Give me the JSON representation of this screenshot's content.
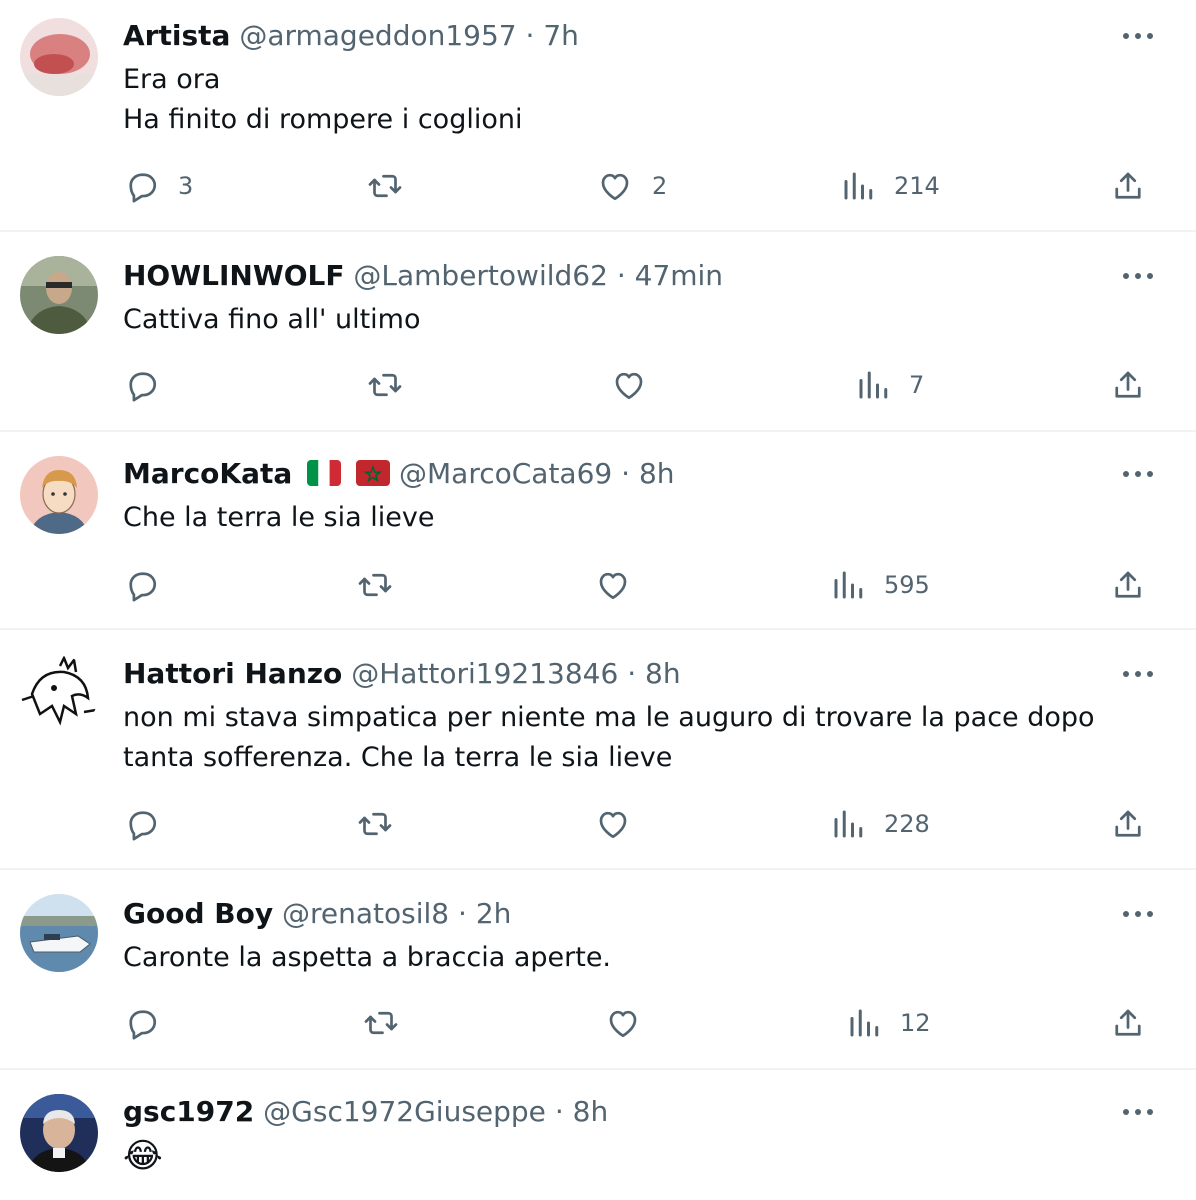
{
  "tweets": [
    {
      "name": "Artista",
      "handle": "@armageddon1957",
      "separator": "·",
      "time": "7h",
      "text": [
        "Era ora",
        "Ha finito di rompere i coglioni"
      ],
      "replies": "3",
      "retweets": "",
      "likes": "2",
      "views": "214"
    },
    {
      "name": "HOWLINWOLF",
      "handle": "@Lambertowild62",
      "separator": "·",
      "time": "47min",
      "text": [
        "Cattiva fino all' ultimo"
      ],
      "replies": "",
      "retweets": "",
      "likes": "",
      "views": "7"
    },
    {
      "name": "MarcoKata",
      "flags": [
        "italy-flag",
        "morocco-flag"
      ],
      "handle": "@MarcoCata69",
      "separator": "·",
      "time": "8h",
      "text": [
        "Che la terra le sia lieve"
      ],
      "replies": "",
      "retweets": "",
      "likes": "",
      "views": "595"
    },
    {
      "name": "Hattori Hanzo",
      "handle": "@Hattori19213846",
      "separator": "·",
      "time": "8h",
      "text": [
        "non mi stava simpatica per niente ma le auguro di trovare la pace dopo",
        "tanta sofferenza. Che la terra le sia lieve"
      ],
      "replies": "",
      "retweets": "",
      "likes": "",
      "views": "228"
    },
    {
      "name": "Good Boy",
      "handle": "@renatosil8",
      "separator": "·",
      "time": "2h",
      "text": [
        "Caronte la aspetta a braccia aperte."
      ],
      "replies": "",
      "retweets": "",
      "likes": "",
      "views": "12"
    },
    {
      "name": "gsc1972",
      "handle": "@Gsc1972Giuseppe",
      "separator": "·",
      "time": "8h",
      "text": [
        "😂"
      ]
    }
  ],
  "colors": {
    "text": "#0f1419",
    "secondary": "#536471",
    "divider": "#eff3f4"
  },
  "icons": {
    "reply": "speech-bubble-icon",
    "retweet": "retweet-arrows-icon",
    "like": "heart-icon",
    "views": "bar-chart-icon",
    "share": "share-upload-icon",
    "more": "more-dots-icon"
  }
}
